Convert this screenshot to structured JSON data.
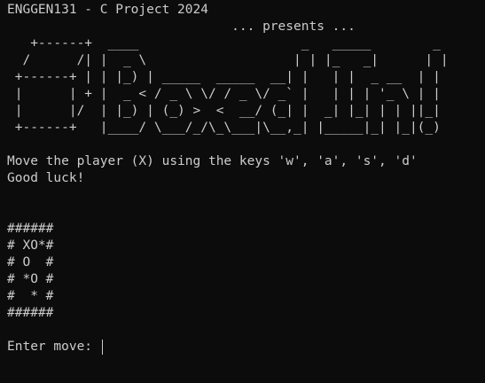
{
  "header": {
    "title": "ENGGEN131 - C Project 2024",
    "presents": "                             ... presents ..."
  },
  "banner_art": "   +------+  ____                     _   _____        _\n  /      /| |  _ \\                   | | |_   _|      | |\n +------+ | | |_) | _____  _____  __| |   | |  _ __  | |\n |      | + |  _ < / _ \\ \\/ / _ \\/ _` |   | | | '_ \\ | |\n |      |/  | |_) | (_) >  <  __/ (_| |  _| |_| | | ||_|\n +------+   |____/ \\___/_/\\_\\___|\\__,_| |_____|_| |_|(_)",
  "instructions": {
    "line1": "Move the player (X) using the keys 'w', 'a', 's', 'd'",
    "line2": "Good luck!"
  },
  "board": {
    "rows": [
      "######",
      "# XO*#",
      "# O  #",
      "# *O #",
      "#  * #",
      "######"
    ]
  },
  "prompt": {
    "label": "Enter move: ",
    "value": ""
  }
}
